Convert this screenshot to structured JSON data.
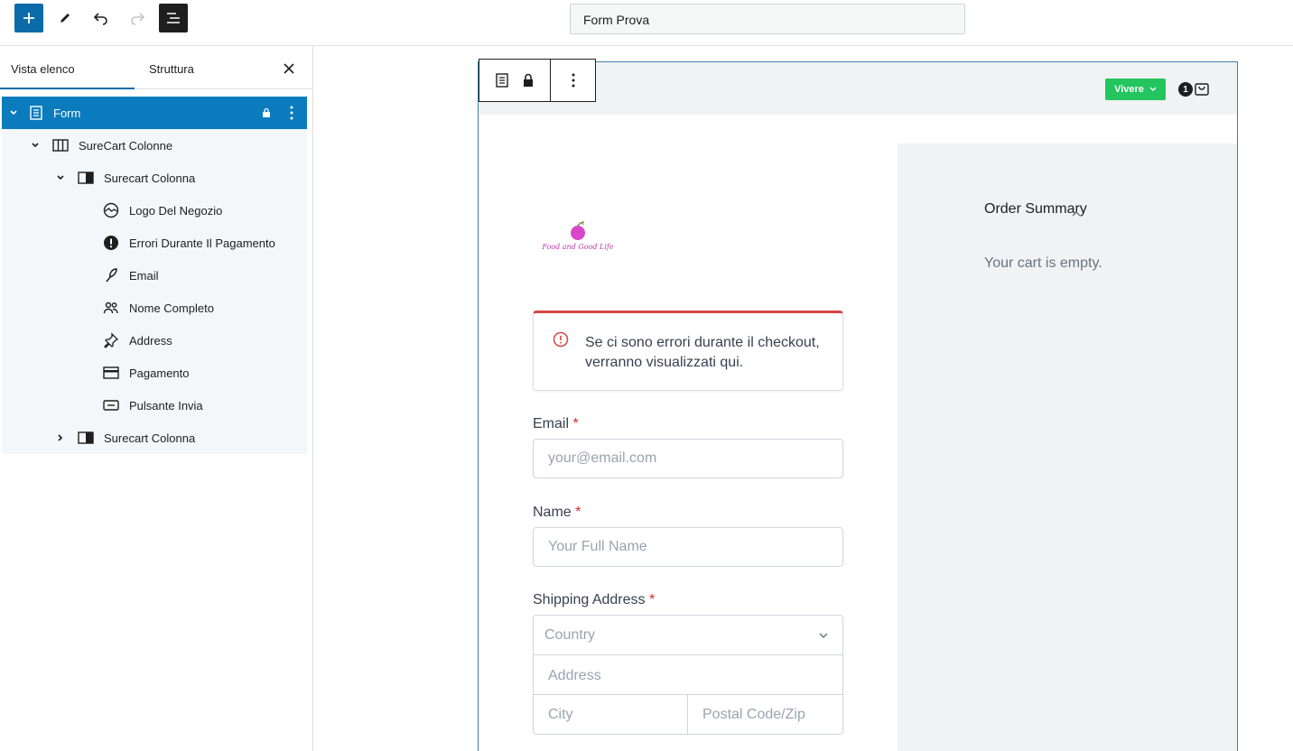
{
  "toolbar": {
    "add": "add-icon",
    "edit": "pencil-icon",
    "undo": "undo-icon",
    "redo": "redo-icon",
    "list_view": "list-view-icon"
  },
  "document": {
    "title": "Form Prova"
  },
  "sidebar": {
    "tabs": [
      {
        "label": "Vista elenco",
        "active": true
      },
      {
        "label": "Struttura",
        "active": false
      }
    ],
    "items": [
      {
        "label": "Form",
        "icon": "form-icon",
        "selected": true,
        "expanded": true,
        "locked": true
      },
      {
        "label": "SureCart Colonne",
        "icon": "columns-icon",
        "expanded": true
      },
      {
        "label": "Surecart Colonna",
        "icon": "column-icon",
        "expanded": true
      },
      {
        "label": "Logo Del Negozio",
        "icon": "store-logo-icon"
      },
      {
        "label": "Errori Durante Il Pagamento",
        "icon": "error-icon"
      },
      {
        "label": "Email",
        "icon": "feather-icon"
      },
      {
        "label": "Nome Completo",
        "icon": "people-icon"
      },
      {
        "label": "Address",
        "icon": "pin-icon"
      },
      {
        "label": "Pagamento",
        "icon": "credit-card-icon"
      },
      {
        "label": "Pulsante Invia",
        "icon": "button-icon"
      },
      {
        "label": "Surecart Colonna",
        "icon": "column-icon",
        "expanded": false
      }
    ]
  },
  "header": {
    "mode_button": "Vivere",
    "cart_count": "1"
  },
  "summary": {
    "title": "Order Summary",
    "empty": "Your cart is empty."
  },
  "logo": {
    "text": "Food and Good Life"
  },
  "errors": {
    "message": "Se ci sono errori durante il checkout, verranno visualizzati qui."
  },
  "form": {
    "email": {
      "label": "Email",
      "required_mark": "*",
      "placeholder": "your@email.com"
    },
    "name": {
      "label": "Name",
      "required_mark": "*",
      "placeholder": "Your Full Name"
    },
    "shipping": {
      "label": "Shipping Address",
      "required_mark": "*",
      "country": "Country",
      "address": "Address",
      "city": "City",
      "postal": "Postal Code/Zip"
    }
  },
  "colors": {
    "accent": "#0a7bbd",
    "live": "#22c55e",
    "error": "#d64545"
  }
}
